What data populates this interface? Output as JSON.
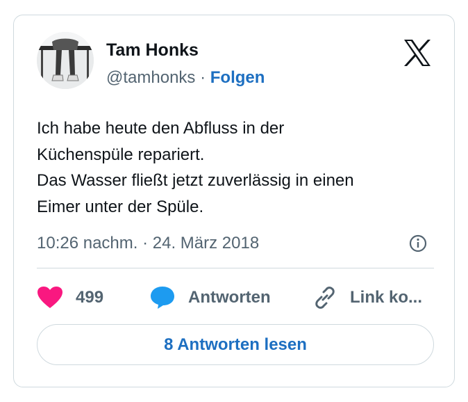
{
  "author": {
    "name": "Tam Honks",
    "handle": "@tamhonks",
    "separator": "·",
    "follow_label": "Folgen",
    "avatar_icon": "profile-photo"
  },
  "brand_icon": "x-logo-icon",
  "tweet": {
    "lines": [
      "Ich habe heute den Abfluss in der",
      "Küchenspüle repariert.",
      "Das Wasser fließt jetzt zuverlässig in einen",
      "Eimer unter der Spüle."
    ],
    "timestamp": "10:26 nachm. · 24. März 2018"
  },
  "actions": {
    "likes_count": "499",
    "reply_label": "Antworten",
    "copy_link_label": "Link ko..."
  },
  "read_replies_label": "8 Antworten lesen",
  "colors": {
    "heart": "#f91880",
    "reply_bubble": "#1d9bf0",
    "link_blue": "#1d6fc1",
    "muted_text": "#536471",
    "border": "#cfd9de"
  }
}
